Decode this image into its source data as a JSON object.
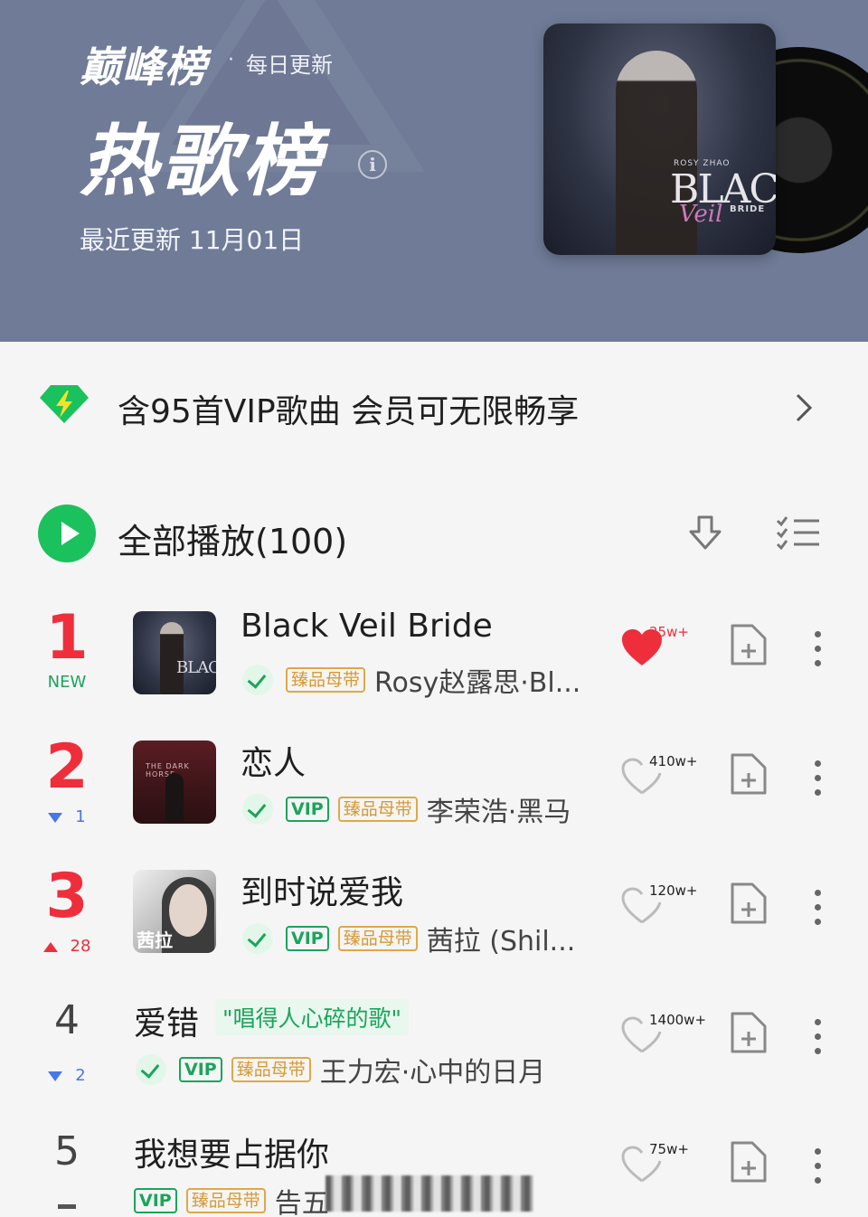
{
  "header": {
    "brand": "巅峰榜",
    "brand_dot": "·",
    "brand_sub": "每日更新",
    "title": "热歌榜",
    "info_icon_glyph": "i",
    "update_text": "最近更新 11月01日",
    "background_color": "#6f7b97",
    "cover": {
      "artist_small": "ROSY ZHAO",
      "title_big": "BLACK",
      "title_script": "Veil",
      "title_small": "BRIDE"
    }
  },
  "vip_banner": {
    "text": "含95首VIP歌曲 会员可无限畅享",
    "icon": "diamond-lightning-icon",
    "arrow_icon": "chevron-right-icon"
  },
  "play_all": {
    "label": "全部播放(100)",
    "icons": [
      "play-icon",
      "download-icon",
      "multi-select-icon"
    ],
    "accent": "#1bc15d"
  },
  "songs": [
    {
      "rank": "1",
      "change": "NEW",
      "change_type": "new",
      "title": "Black Veil Bride",
      "badges": [
        "臻品母带"
      ],
      "artist": "Rosy赵露思·Bl...",
      "likes": "25w+",
      "liked": true,
      "cover_text": "BLACK"
    },
    {
      "rank": "2",
      "change": "1",
      "change_type": "down",
      "title": "恋人",
      "badges_vip": "VIP",
      "badges": [
        "臻品母带"
      ],
      "artist": "李荣浩·黑马",
      "likes": "410w+",
      "liked": false,
      "cover_text": "THE DARK HORSE"
    },
    {
      "rank": "3",
      "change": "28",
      "change_type": "up",
      "title": "到时说爱我",
      "badges_vip": "VIP",
      "badges": [
        "臻品母带"
      ],
      "artist": "茜拉 (Shil...",
      "likes": "120w+",
      "liked": false,
      "cover_text": "茜拉"
    },
    {
      "rank": "4",
      "change": "2",
      "change_type": "down",
      "title": "爱错",
      "tagline": "\"唱得人心碎的歌\"",
      "badges_vip": "VIP",
      "badges": [
        "臻品母带"
      ],
      "artist": "王力宏·心中的日月",
      "likes": "1400w+",
      "liked": false
    },
    {
      "rank": "5",
      "change": "",
      "change_type": "same",
      "title": "我想要占据你",
      "badges_vip": "VIP",
      "badges": [
        "臻品母带"
      ],
      "artist": "告五",
      "likes": "75w+",
      "liked": false
    }
  ],
  "colors": {
    "rank_top": "#ef2e3c",
    "green": "#1aa55b",
    "gold": "#d79a32",
    "down_blue": "#4678e6"
  }
}
